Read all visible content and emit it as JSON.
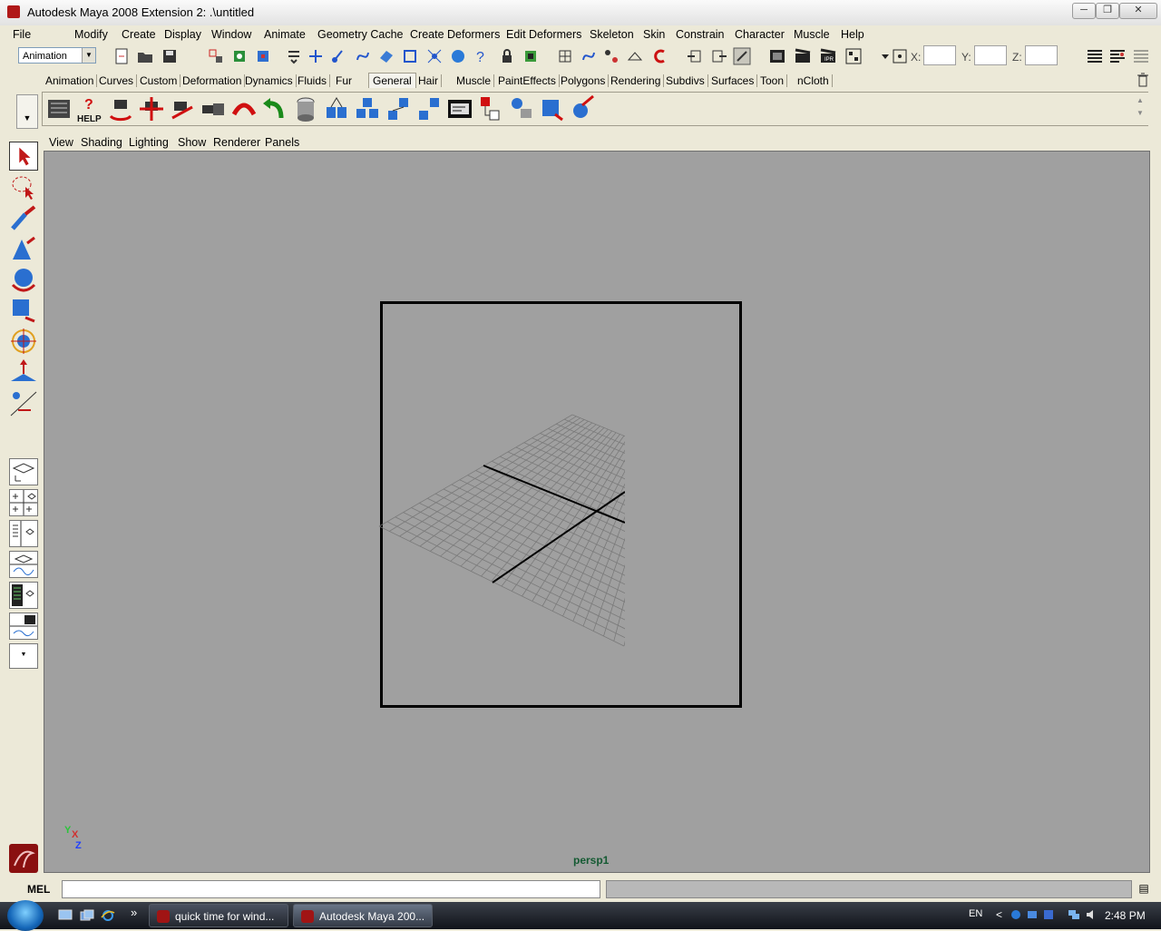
{
  "window": {
    "title": "Autodesk Maya 2008 Extension 2: .\\untitled",
    "minimize": "─",
    "maximize": "❐",
    "close": "✕"
  },
  "menu": [
    "File",
    "Modify",
    "Create",
    "Display",
    "Window",
    "Animate",
    "Geometry Cache",
    "Create Deformers",
    "Edit Deformers",
    "Skeleton",
    "Skin",
    "Constrain",
    "Character",
    "Muscle",
    "Help"
  ],
  "status_line": {
    "mode": "Animation",
    "x_label": "X:",
    "y_label": "Y:",
    "z_label": "Z:"
  },
  "shelf_tabs": [
    "Animation",
    "Curves",
    "Custom",
    "Deformation",
    "Dynamics",
    "Fluids",
    "Fur",
    "General",
    "Hair",
    "Muscle",
    "PaintEffects",
    "Polygons",
    "Rendering",
    "Subdivs",
    "Surfaces",
    "Toon",
    "nCloth"
  ],
  "active_shelf_tab": "General",
  "shelf_help_label": "HELP",
  "panel_menu": [
    "View",
    "Shading",
    "Lighting",
    "Show",
    "Renderer",
    "Panels"
  ],
  "viewport": {
    "camera": "persp1",
    "axis": {
      "y": "Y",
      "x": "X",
      "z": "Z"
    },
    "background": "#a0a0a0"
  },
  "command_line": {
    "label": "MEL",
    "value": "",
    "result": ""
  },
  "taskbar": {
    "items": [
      "quick time for wind...",
      "Autodesk Maya 200..."
    ],
    "more": "»",
    "language": "EN",
    "tray_chevron": "<",
    "time": "2:48 PM"
  }
}
